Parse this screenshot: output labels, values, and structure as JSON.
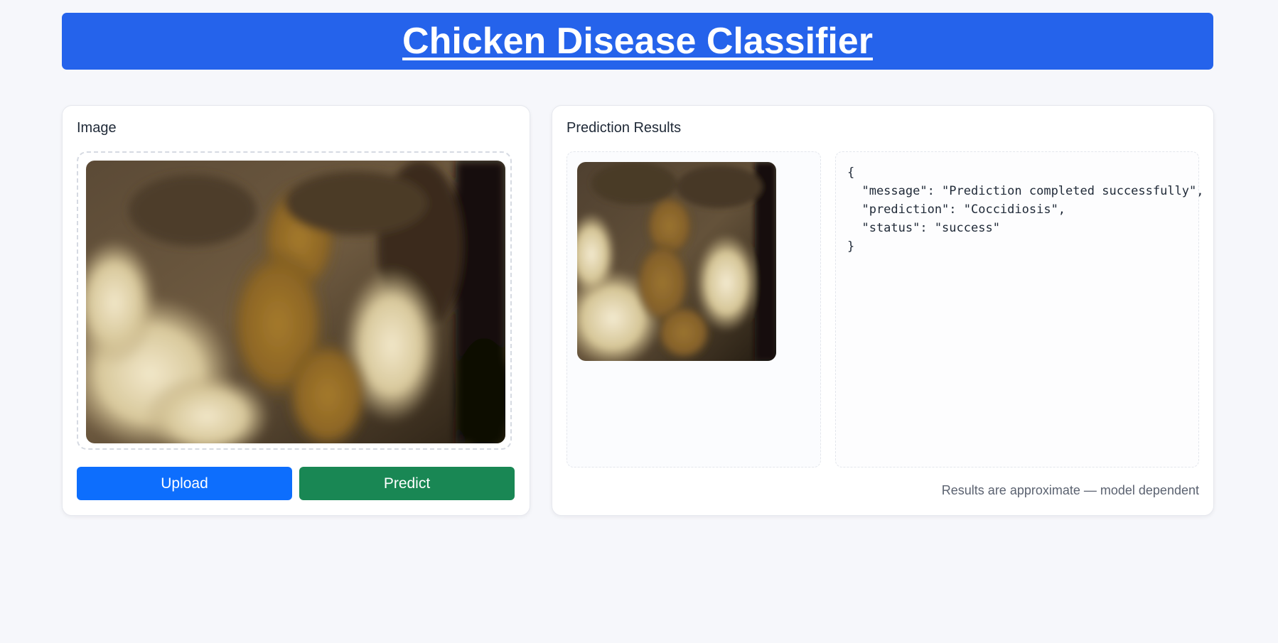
{
  "header": {
    "title": "Chicken Disease Classifier",
    "color": "#2563eb"
  },
  "image_card": {
    "title": "Image",
    "image_icon": "chicken-droppings-photo",
    "buttons": {
      "upload_label": "Upload",
      "upload_color": "#0d6efd",
      "predict_label": "Predict",
      "predict_color": "#198754"
    }
  },
  "results_card": {
    "title": "Prediction Results",
    "thumbnail_icon": "chicken-droppings-photo",
    "json_lines": [
      "{",
      "  \"message\": \"Prediction completed successfully\",",
      "  \"prediction\": \"Coccidiosis\",",
      "  \"status\": \"success\"",
      "}"
    ],
    "footnote": "Results are approximate — model dependent"
  }
}
